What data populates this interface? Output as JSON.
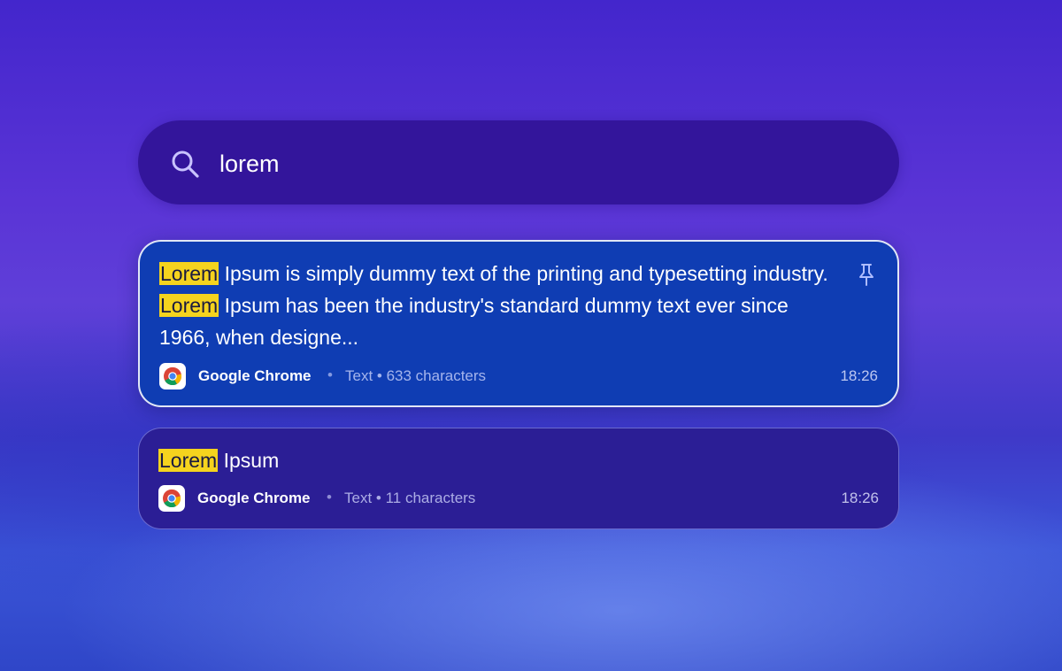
{
  "search": {
    "query": "lorem"
  },
  "results": [
    {
      "text_parts": [
        {
          "text": "Lorem",
          "highlight": true
        },
        {
          "text": " Ipsum is simply dummy text of the printing and typesetting industry. ",
          "highlight": false
        },
        {
          "text": "Lorem",
          "highlight": true
        },
        {
          "text": " Ipsum has been the industry's standard dummy text ever since 1966, when designe...",
          "highlight": false
        }
      ],
      "app": "Google Chrome",
      "separator": "•",
      "info": "Text • 633 characters",
      "time": "18:26",
      "pinned_icon": "pin-icon",
      "selected": true
    },
    {
      "text_parts": [
        {
          "text": "Lorem",
          "highlight": true
        },
        {
          "text": " Ipsum",
          "highlight": false
        }
      ],
      "app": "Google Chrome",
      "separator": "•",
      "info": "Text • 11 characters",
      "time": "18:26",
      "selected": false
    }
  ],
  "colors": {
    "highlight": "#f5d31e",
    "selected_card": "#0f3db3",
    "card": "#2b1e95",
    "search_bar": "#33159b"
  }
}
